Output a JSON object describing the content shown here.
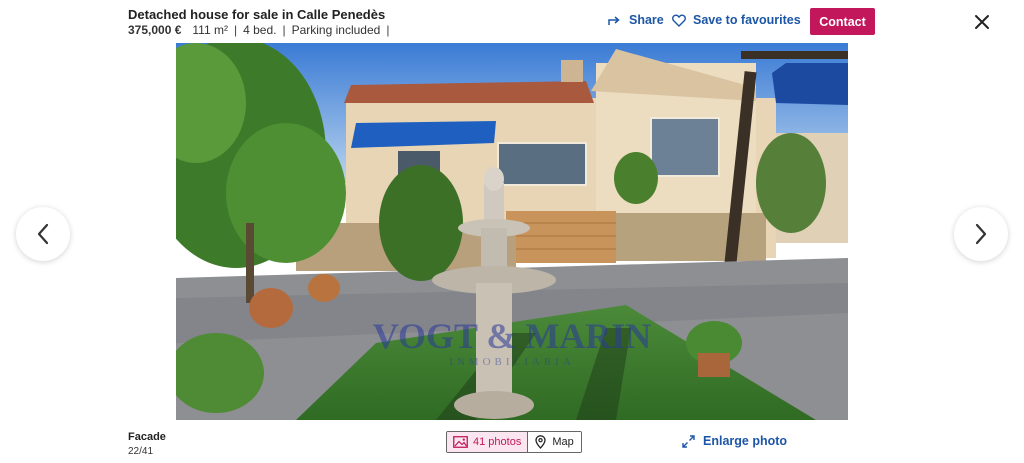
{
  "header": {
    "title": "Detached house for sale in Calle Penedès",
    "price": "375,000 €",
    "features": [
      "111 m²",
      "4 bed.",
      "Parking included"
    ],
    "share_label": "Share",
    "favourite_label": "Save to favourites",
    "contact_label": "Contact"
  },
  "photo": {
    "watermark": "VOGT & MARIN",
    "watermark_sub": "INMOBILIARIA",
    "description": "Facade"
  },
  "footer": {
    "caption": "Facade",
    "counter": "22/41",
    "photos_label": "41 photos",
    "map_label": "Map",
    "enlarge_label": "Enlarge photo"
  },
  "colors": {
    "accent": "#c2185b",
    "link": "#1d56a6"
  }
}
